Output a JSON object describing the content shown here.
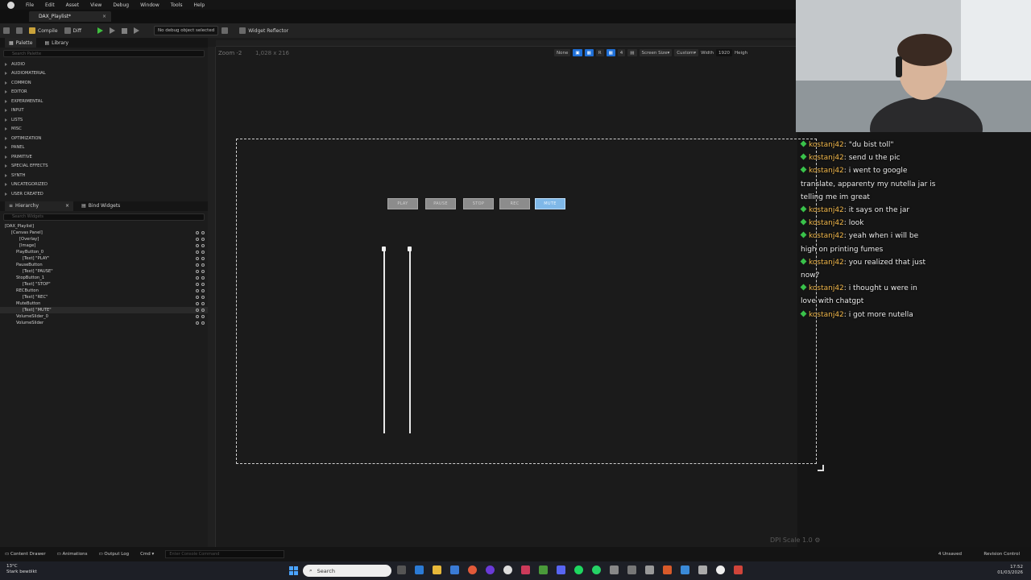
{
  "menubar": {
    "items": [
      "File",
      "Edit",
      "Asset",
      "View",
      "Debug",
      "Window",
      "Tools",
      "Help"
    ]
  },
  "tab": {
    "title": "DAX_Playlist*"
  },
  "toolbar": {
    "compile": "Compile",
    "diff": "Diff",
    "debug_select": "No debug object selected",
    "widget_reflector": "Widget Reflector"
  },
  "palette": {
    "title": "Palette",
    "library": "Library",
    "search_placeholder": "Search Palette",
    "categories": [
      "AUDIO",
      "AUDIOMATERIAL",
      "COMMON",
      "EDITOR",
      "EXPERIMENTAL",
      "INPUT",
      "LISTS",
      "MISC",
      "OPTIMIZATION",
      "PANEL",
      "PRIMITIVE",
      "SPECIAL EFFECTS",
      "SYNTH",
      "UNCATEGORIZED",
      "USER CREATED"
    ]
  },
  "hierarchy": {
    "title": "Hierarchy",
    "bind": "Bind Widgets",
    "search_placeholder": "Search Widgets",
    "items": [
      "[DAX_Playlist]",
      "[Canvas Panel]",
      "[Overlay]",
      "[Image]",
      "PlayButton_0",
      "[Text] \"PLAY\"",
      "PauseButton",
      "[Text] \"PAUSE\"",
      "StopButton_1",
      "[Text] \"STOP\"",
      "RECButton",
      "[Text] \"REC\"",
      "MuteButton",
      "[Text] \"MUTE\"",
      "VolumeSlider_0",
      "VolumeSlider"
    ]
  },
  "viewport": {
    "zoom": "Zoom -2",
    "size": "1,028 x 216",
    "none_label": "None",
    "r_label": "R",
    "four_label": "4",
    "screen_size": "Screen Size",
    "custom": "Custom",
    "width_label": "Width",
    "width_value": "1920",
    "height_label": "Heigh",
    "dpi": "DPI Scale 1.0"
  },
  "widget_buttons": [
    "PLAY",
    "PAUSE",
    "STOP",
    "REC",
    "MUTE"
  ],
  "bottombar": {
    "content_drawer": "Content Drawer",
    "animations": "Animations",
    "output_log": "Output Log",
    "cmd": "Cmd",
    "console_placeholder": "Enter Console Command",
    "unsaved": "4 Unsaved",
    "revision": "Revision Control"
  },
  "taskbar": {
    "weather_temp": "13°C",
    "weather_desc": "Stark bewölkt",
    "search": "Search",
    "time": "17:52",
    "date": "01/03/2026"
  },
  "chat": [
    {
      "user": "kostanj42",
      "text": ": \"du bist toll\""
    },
    {
      "user": "kostanj42",
      "text": ": send u the pic"
    },
    {
      "user": "kostanj42",
      "text": ": i went to google"
    },
    {
      "user": "",
      "text": "translate, apparenty my nutella jar is"
    },
    {
      "user": "",
      "text": "telling me im great"
    },
    {
      "user": "kostanj42",
      "text": ": it says on the jar"
    },
    {
      "user": "kostanj42",
      "text": ": look"
    },
    {
      "user": "kostanj42",
      "text": ": yeah when i will be"
    },
    {
      "user": "",
      "text": "high on printing fumes"
    },
    {
      "user": "kostanj42",
      "text": ": you realized that just"
    },
    {
      "user": "",
      "text": "now?"
    },
    {
      "user": "kostanj42",
      "text": ": i thought u were in"
    },
    {
      "user": "",
      "text": "love with chatgpt"
    },
    {
      "user": "kostanj42",
      "text": ": i got more nutella"
    }
  ],
  "colors": {
    "accent": "#1f6fd6",
    "chat_user": "#f2b84b",
    "badge": "#39c24a",
    "selected_button": "#7fb8e8"
  }
}
